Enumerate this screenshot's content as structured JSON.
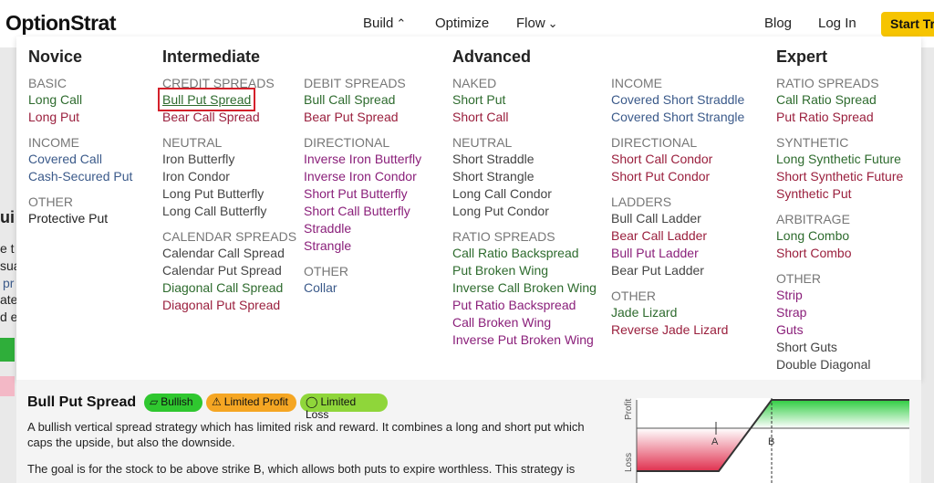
{
  "header": {
    "logo": "OptionStrat",
    "nav": {
      "build": "Build",
      "optimize": "Optimize",
      "flow": "Flow",
      "blog": "Blog",
      "login": "Log In",
      "start": "Start Tri"
    }
  },
  "background": {
    "fragments": [
      "ui",
      "e t",
      "sua",
      "pr",
      "ate",
      "d e"
    ]
  },
  "menu": {
    "novice": {
      "title": "Novice",
      "basic": "BASIC",
      "long_call": "Long Call",
      "long_put": "Long Put",
      "income": "INCOME",
      "covered_call": "Covered Call",
      "cash_secured_put": "Cash-Secured Put",
      "other": "OTHER",
      "protective_put": "Protective Put"
    },
    "intermediate": {
      "title": "Intermediate",
      "credit_spreads": "CREDIT SPREADS",
      "bull_put_spread": "Bull Put Spread",
      "bear_call_spread": "Bear Call Spread",
      "neutral": "NEUTRAL",
      "iron_butterfly": "Iron Butterfly",
      "iron_condor": "Iron Condor",
      "long_put_butterfly": "Long Put Butterfly",
      "long_call_butterfly": "Long Call Butterfly",
      "calendar_spreads": "CALENDAR SPREADS",
      "calendar_call_spread": "Calendar Call Spread",
      "calendar_put_spread": "Calendar Put Spread",
      "diagonal_call_spread": "Diagonal Call Spread",
      "diagonal_put_spread": "Diagonal Put Spread",
      "debit_spreads": "DEBIT SPREADS",
      "bull_call_spread": "Bull Call Spread",
      "bear_put_spread": "Bear Put Spread",
      "directional": "DIRECTIONAL",
      "inverse_iron_butterfly": "Inverse Iron Butterfly",
      "inverse_iron_condor": "Inverse Iron Condor",
      "short_put_butterfly": "Short Put Butterfly",
      "short_call_butterfly": "Short Call Butterfly",
      "straddle": "Straddle",
      "strangle": "Strangle",
      "other": "OTHER",
      "collar": "Collar"
    },
    "advanced": {
      "title": "Advanced",
      "naked": "NAKED",
      "short_put": "Short Put",
      "short_call": "Short Call",
      "neutral": "NEUTRAL",
      "short_straddle": "Short Straddle",
      "short_strangle": "Short Strangle",
      "long_call_condor": "Long Call Condor",
      "long_put_condor": "Long Put Condor",
      "ratio_spreads": "RATIO SPREADS",
      "call_ratio_backspread": "Call Ratio Backspread",
      "put_broken_wing": "Put Broken Wing",
      "inverse_call_broken_wing": "Inverse Call Broken Wing",
      "put_ratio_backspread": "Put Ratio Backspread",
      "call_broken_wing": "Call Broken Wing",
      "inverse_put_broken_wing": "Inverse Put Broken Wing",
      "income": "INCOME",
      "covered_short_straddle": "Covered Short Straddle",
      "covered_short_strangle": "Covered Short Strangle",
      "directional": "DIRECTIONAL",
      "short_call_condor": "Short Call Condor",
      "short_put_condor": "Short Put Condor",
      "ladders": "LADDERS",
      "bull_call_ladder": "Bull Call Ladder",
      "bear_call_ladder": "Bear Call Ladder",
      "bull_put_ladder": "Bull Put Ladder",
      "bear_put_ladder": "Bear Put Ladder",
      "other": "OTHER",
      "jade_lizard": "Jade Lizard",
      "reverse_jade_lizard": "Reverse Jade Lizard"
    },
    "expert": {
      "title": "Expert",
      "ratio_spreads": "RATIO SPREADS",
      "call_ratio_spread": "Call Ratio Spread",
      "put_ratio_spread": "Put Ratio Spread",
      "synthetic": "SYNTHETIC",
      "long_synthetic_future": "Long Synthetic Future",
      "short_synthetic_future": "Short Synthetic Future",
      "synthetic_put": "Synthetic Put",
      "arbitrage": "ARBITRAGE",
      "long_combo": "Long Combo",
      "short_combo": "Short Combo",
      "other": "OTHER",
      "strip": "Strip",
      "strap": "Strap",
      "guts": "Guts",
      "short_guts": "Short Guts",
      "double_diagonal": "Double Diagonal"
    }
  },
  "info": {
    "title": "Bull Put Spread",
    "badges": {
      "bullish": "Bullish",
      "limited_profit": "Limited Profit",
      "limited_loss": "Limited Loss"
    },
    "desc1": "A bullish vertical spread strategy which has limited risk and reward. It combines a long and short put which caps the upside, but also the downside.",
    "desc2": "The goal is for the stock to be above strike B, which allows both puts to expire worthless. This strategy is",
    "chart": {
      "profit_label": "Profit",
      "loss_label": "Loss",
      "strike_a": "A",
      "strike_b": "B",
      "profit_color": "#2ecc40",
      "loss_color": "#e0314f"
    }
  }
}
